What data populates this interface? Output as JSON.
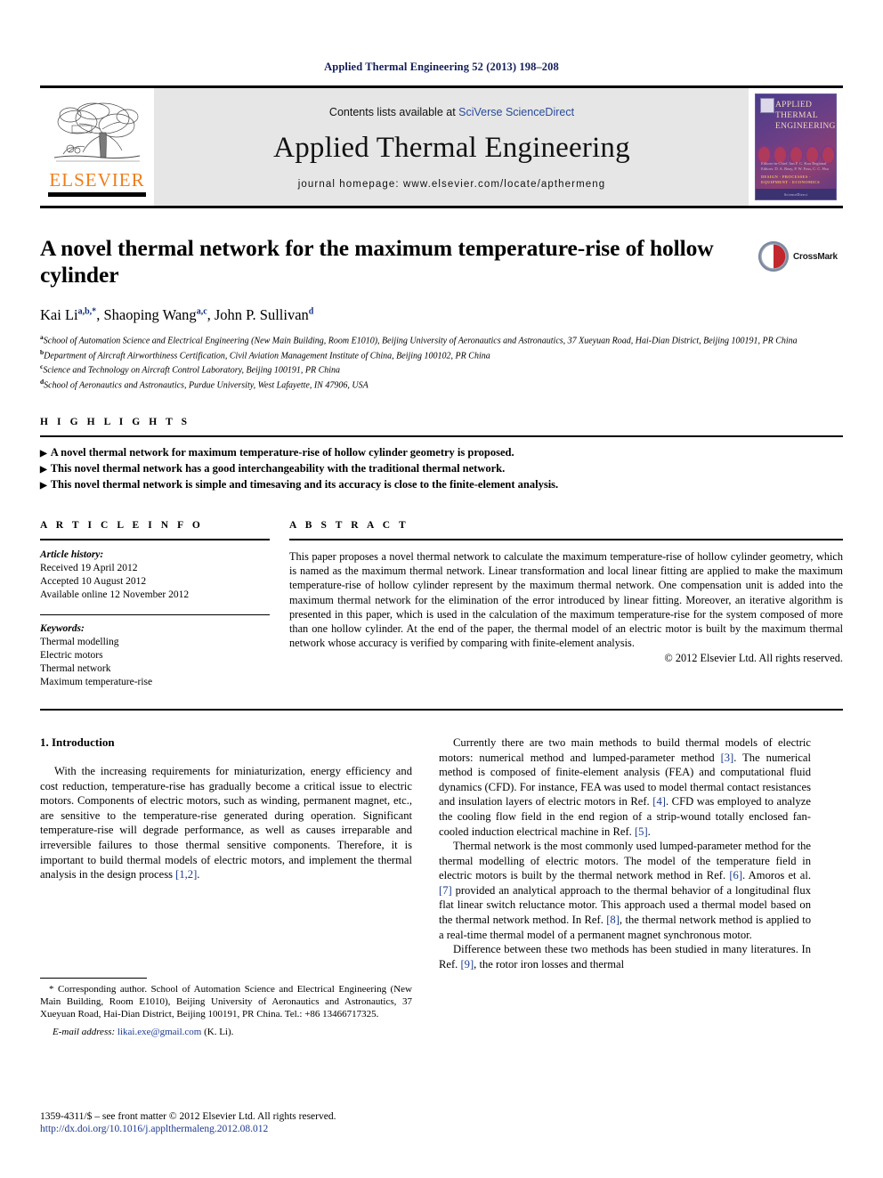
{
  "running_head": "Applied Thermal Engineering 52 (2013) 198–208",
  "masthead": {
    "contents_prefix": "Contents lists available at ",
    "contents_link": "SciVerse ScienceDirect",
    "journal_name": "Applied Thermal Engineering",
    "homepage": "journal homepage: www.elsevier.com/locate/apthermeng",
    "publisher_name": "ELSEVIER",
    "cover": {
      "title_line1": "APPLIED",
      "title_line2": "THERMAL",
      "title_line3": "ENGINEERING",
      "editors": "Editors-in-Chief: Ian F. C. Kou\nRegional Editors: D. A. Reay, P. W. Foss, C. C. Hsu",
      "topics": "DESIGN · PROCESSES · EQUIPMENT · ECONOMICS",
      "publisher": "ScienceDirect"
    }
  },
  "article": {
    "title": "A novel thermal network for the maximum temperature-rise of hollow cylinder",
    "crossmark_label": "CrossMark",
    "authors": [
      {
        "name": "Kai Li",
        "sup": "a,b,*"
      },
      {
        "name": "Shaoping Wang",
        "sup": "a,c"
      },
      {
        "name": "John P. Sullivan",
        "sup": "d"
      }
    ],
    "affiliations": [
      {
        "mark": "a",
        "text": "School of Automation Science and Electrical Engineering (New Main Building, Room E1010), Beijing University of Aeronautics and Astronautics, 37 Xueyuan Road, Hai-Dian District, Beijing 100191, PR China"
      },
      {
        "mark": "b",
        "text": "Department of Aircraft Airworthiness Certification, Civil Aviation Management Institute of China, Beijing 100102, PR China"
      },
      {
        "mark": "c",
        "text": "Science and Technology on Aircraft Control Laboratory, Beijing 100191, PR China"
      },
      {
        "mark": "d",
        "text": "School of Aeronautics and Astronautics, Purdue University, West Lafayette, IN 47906, USA"
      }
    ]
  },
  "highlights": {
    "heading": "H I G H L I G H T S",
    "bullet_glyph": "▶",
    "items": [
      "A novel thermal network for maximum temperature-rise of hollow cylinder geometry is proposed.",
      "This novel thermal network has a good interchangeability with the traditional thermal network.",
      "This novel thermal network is simple and timesaving and its accuracy is close to the finite-element analysis."
    ]
  },
  "article_info": {
    "heading": "A R T I C L E    I N F O",
    "history_title": "Article history:",
    "history": [
      "Received 19 April 2012",
      "Accepted 10 August 2012",
      "Available online 12 November 2012"
    ],
    "keywords_title": "Keywords:",
    "keywords": [
      "Thermal modelling",
      "Electric motors",
      "Thermal network",
      "Maximum temperature-rise"
    ]
  },
  "abstract": {
    "heading": "A B S T R A C T",
    "body": "This paper proposes a novel thermal network to calculate the maximum temperature-rise of hollow cylinder geometry, which is named as the maximum thermal network. Linear transformation and local linear fitting are applied to make the maximum temperature-rise of hollow cylinder represent by the maximum thermal network. One compensation unit is added into the maximum thermal network for the elimination of the error introduced by linear fitting. Moreover, an iterative algorithm is presented in this paper, which is used in the calculation of the maximum temperature-rise for the system composed of more than one hollow cylinder. At the end of the paper, the thermal model of an electric motor is built by the maximum thermal network whose accuracy is verified by comparing with finite-element analysis.",
    "copyright": "© 2012 Elsevier Ltd. All rights reserved."
  },
  "body": {
    "section_number_title": "1.  Introduction",
    "left_paragraphs": [
      {
        "parts": [
          {
            "t": "With the increasing requirements for miniaturization, energy efficiency and cost reduction, temperature-rise has gradually become a critical issue to electric motors. Components of electric motors, such as winding, permanent magnet, etc., are sensitive to the temperature-rise generated during operation. Significant temperature-rise will degrade performance, as well as causes irreparable and irreversible failures to those thermal sensitive components. Therefore, it is important to build thermal models of electric motors, and implement the thermal analysis in the design process "
          },
          {
            "t": "[1,2]",
            "cite": true
          },
          {
            "t": "."
          }
        ]
      }
    ],
    "right_paragraphs": [
      {
        "parts": [
          {
            "t": "Currently there are two main methods to build thermal models of electric motors: numerical method and lumped-parameter method "
          },
          {
            "t": "[3]",
            "cite": true
          },
          {
            "t": ". The numerical method is composed of finite-element analysis (FEA) and computational fluid dynamics (CFD). For instance, FEA was used to model thermal contact resistances and insulation layers of electric motors in Ref. "
          },
          {
            "t": "[4]",
            "cite": true
          },
          {
            "t": ". CFD was employed to analyze the cooling flow field in the end region of a strip-wound totally enclosed fan-cooled induction electrical machine in Ref. "
          },
          {
            "t": "[5]",
            "cite": true
          },
          {
            "t": "."
          }
        ]
      },
      {
        "parts": [
          {
            "t": "Thermal network is the most commonly used lumped-parameter method for the thermal modelling of electric motors. The model of the temperature field in electric motors is built by the thermal network method in Ref. "
          },
          {
            "t": "[6]",
            "cite": true
          },
          {
            "t": ". Amoros et al. "
          },
          {
            "t": "[7]",
            "cite": true
          },
          {
            "t": " provided an analytical approach to the thermal behavior of a longitudinal flux flat linear switch reluctance motor. This approach used a thermal model based on the thermal network method. In Ref. "
          },
          {
            "t": "[8]",
            "cite": true
          },
          {
            "t": ", the thermal network method is applied to a real-time thermal model of a permanent magnet synchronous motor."
          }
        ]
      },
      {
        "parts": [
          {
            "t": "Difference between these two methods has been studied in many literatures. In Ref. "
          },
          {
            "t": "[9]",
            "cite": true
          },
          {
            "t": ", the rotor iron losses and thermal"
          }
        ]
      }
    ]
  },
  "footnote": {
    "parts": [
      {
        "t": "* Corresponding author. School of Automation Science and Electrical Engineering (New Main Building, Room E1010), Beijing University of Aeronautics and Astronautics, 37 Xueyuan Road, Hai-Dian District, Beijing 100191, PR China. Tel.: +86 13466717325."
      }
    ],
    "email_label": "E-mail address:",
    "email": "likai.exe@gmail.com",
    "email_owner": "(K. Li)."
  },
  "page_footer": {
    "issn_line": "1359-4311/$ – see front matter © 2012 Elsevier Ltd. All rights reserved.",
    "doi_line": "http://dx.doi.org/10.1016/j.applthermaleng.2012.08.012"
  },
  "colors": {
    "link_blue": "#1b3a8f",
    "runhead_navy": "#141e5a",
    "elsevier_orange": "#ef7d1a",
    "masthead_grey": "#e6e6e6"
  }
}
